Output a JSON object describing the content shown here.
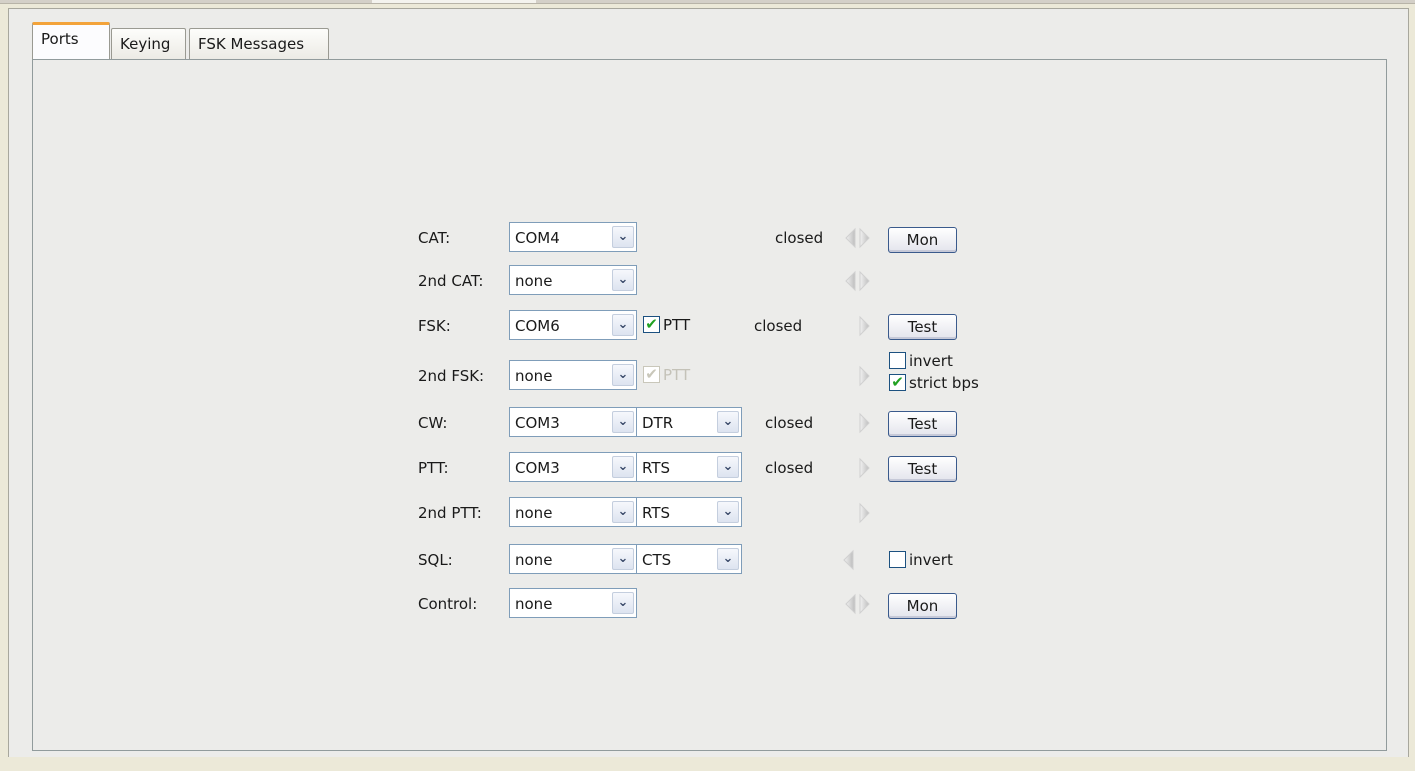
{
  "tabs": [
    {
      "label": "Ports",
      "active": true
    },
    {
      "label": "Keying",
      "active": false
    },
    {
      "label": "FSK Messages",
      "active": false
    }
  ],
  "ports": {
    "cat": {
      "label": "CAT:",
      "port": "COM4",
      "status": "closed",
      "button": "Mon"
    },
    "cat2": {
      "label": "2nd CAT:",
      "port": "none"
    },
    "fsk": {
      "label": "FSK:",
      "port": "COM6",
      "ptt_label": "PTT",
      "ptt_checked": true,
      "status": "closed",
      "button": "Test"
    },
    "fsk2": {
      "label": "2nd FSK:",
      "port": "none",
      "ptt_label": "PTT",
      "ptt_checked": true,
      "ptt_disabled": true,
      "invert_label": "invert",
      "invert_checked": false,
      "strict_label": "strict bps",
      "strict_checked": true
    },
    "cw": {
      "label": "CW:",
      "port": "COM3",
      "line": "DTR",
      "status": "closed",
      "button": "Test"
    },
    "ptt": {
      "label": "PTT:",
      "port": "COM3",
      "line": "RTS",
      "status": "closed",
      "button": "Test"
    },
    "ptt2": {
      "label": "2nd PTT:",
      "port": "none",
      "line": "RTS"
    },
    "sql": {
      "label": "SQL:",
      "port": "none",
      "line": "CTS",
      "invert_label": "invert",
      "invert_checked": false
    },
    "control": {
      "label": "Control:",
      "port": "none",
      "button": "Mon"
    }
  },
  "icons": {
    "rx": "rx-arrow-icon",
    "tx": "tx-arrow-icon",
    "combo": "chevron-down-icon"
  },
  "colors": {
    "tab_accent": "#f3a33a",
    "check_mark": "#21a121",
    "indicator_off": "#c8c8c8"
  }
}
